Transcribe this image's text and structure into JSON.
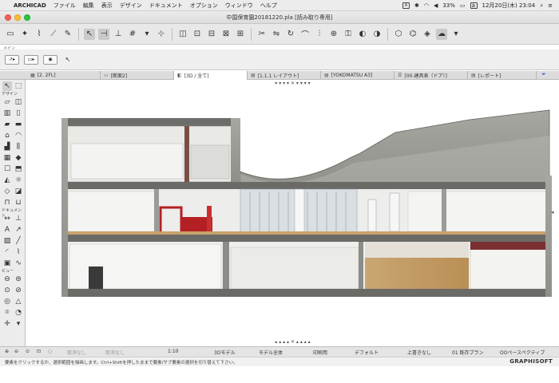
{
  "menubar": {
    "app": "ARCHICAD",
    "items": [
      "ファイル",
      "編集",
      "表示",
      "デザイン",
      "ドキュメント",
      "オプション",
      "ウィンドウ",
      "ヘルプ"
    ],
    "battery": "33%",
    "datetime": "12月20日(木)  23:04"
  },
  "window": {
    "title": "中国保育園20181220.pla [読み取り専用]"
  },
  "infobox": {
    "label": "メイン"
  },
  "tabs": [
    {
      "label": "[2. 2FL]",
      "icon": "floor-plan-icon"
    },
    {
      "label": "[断面2]",
      "icon": "section-icon"
    },
    {
      "label": "[3D / 全て]",
      "icon": "3d-icon"
    },
    {
      "label": "[1.1.1 レイアウト]",
      "icon": "layout-icon"
    },
    {
      "label": "[YOKOMATSU A3]",
      "icon": "layout-icon"
    },
    {
      "label": "[00-建具表（ドア）]",
      "icon": "schedule-icon"
    },
    {
      "label": "[レポート]",
      "icon": "report-icon"
    }
  ],
  "toolbox": {
    "design_label": "デザイン",
    "document_label": "ドキュメント",
    "view_label": "ビュー"
  },
  "bottombar": {
    "undo": "取消なし",
    "redo": "取消なし",
    "scale": "1:10",
    "model_view": "3Dモデル",
    "model_all": "モデル全体",
    "print": "印刷用",
    "default": "デフォルト",
    "override": "上書きなし",
    "renovation": "01 既存プラン",
    "perspective": "OOペースペクティブ"
  },
  "statusbar": {
    "hint": "要素をクリックするか、選択範囲を描画します。Ctrl+Shiftを押したままで要素/サブ要素の選択を切り替えて下さい。",
    "brand": "GRAPHISOFT"
  },
  "colors": {
    "concrete": "#9c9c98",
    "wood_floor": "#c9a36a",
    "red_accent": "#b32024",
    "glass": "#cfd8dc"
  }
}
